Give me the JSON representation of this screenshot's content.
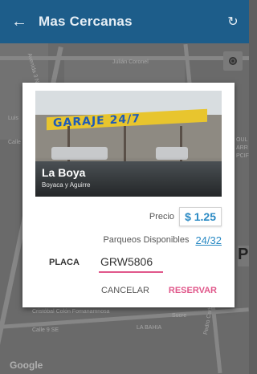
{
  "appbar": {
    "title": "Mas Cercanas",
    "back_icon": "back-arrow-icon",
    "refresh_icon": "refresh-icon",
    "color": "#1d5d8a"
  },
  "map": {
    "streets": [
      "Julián Coronel",
      "Avenida 3 NO",
      "Cristóbal Colón Fomanamnosa",
      "Calle 9 SE",
      "Sucre",
      "LA BAHIA",
      "Pedro Carbo",
      "Calle",
      "Luis"
    ],
    "side_text": [
      "OUL",
      "ARR",
      "PCIF"
    ],
    "attribution": "Google",
    "location_button_icon": "my-location-icon",
    "marker_letter": "P"
  },
  "dialog": {
    "photo": {
      "sign_text": "GARAJE 24/7",
      "name": "La Boya",
      "address": "Boyaca y Aguirre"
    },
    "price_label": "Precio",
    "price_value": "$ 1.25",
    "spots_label": "Parqueos Disponibles",
    "spots_value": "24/32",
    "plate_label": "PLACA",
    "plate_value": "GRW5806",
    "cancel_label": "CANCELAR",
    "reserve_label": "RESERVAR",
    "accent_color": "#e0578a",
    "value_color": "#2a8ac4"
  }
}
